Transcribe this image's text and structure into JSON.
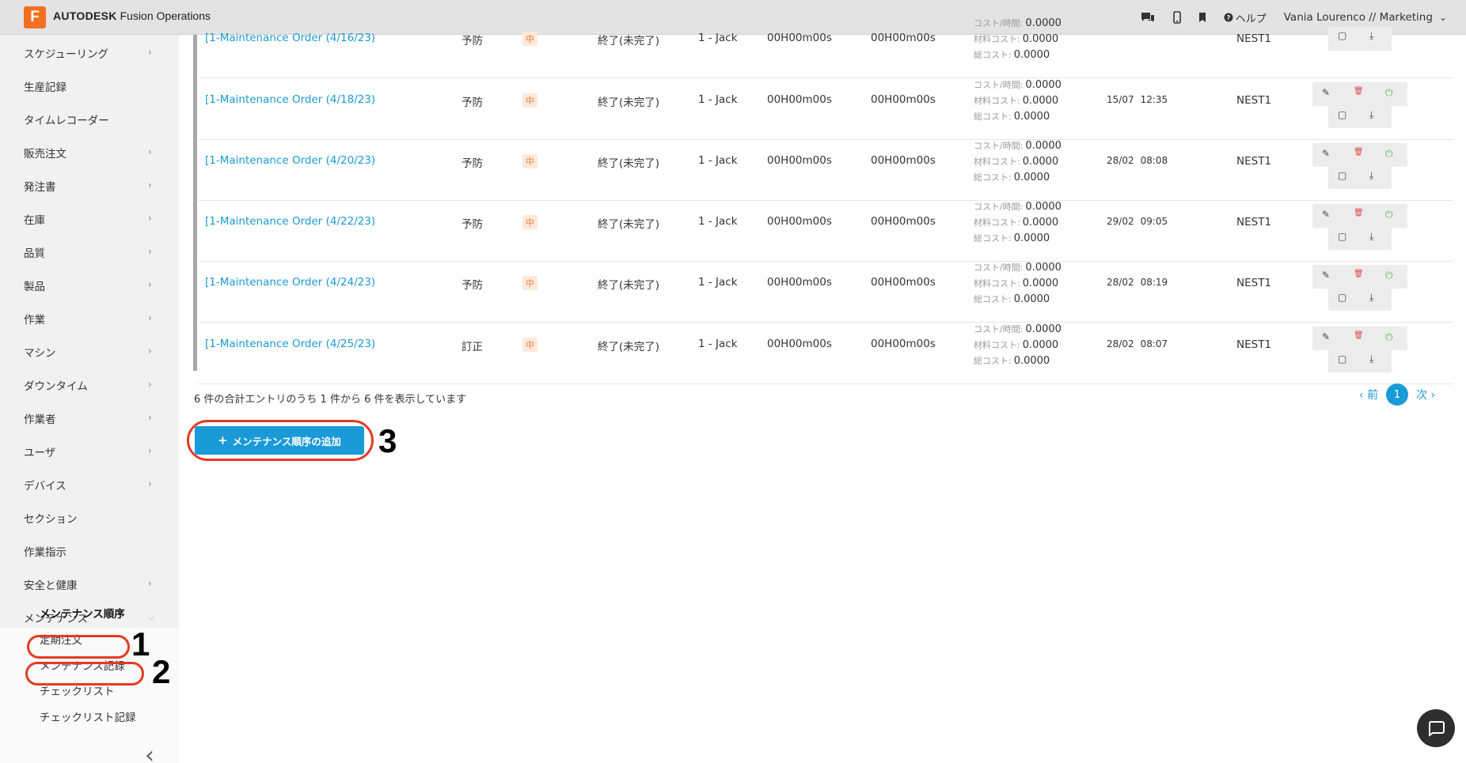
{
  "header": {
    "logo_letter": "F",
    "brand_bold": "AUTODESK",
    "brand_product": "Fusion Operations",
    "help_label": "ヘルプ",
    "user_label": "Vania Lourenco // Marketing"
  },
  "sidebar": {
    "items": [
      {
        "label": "スケジューリング",
        "chevron": true
      },
      {
        "label": "生産記録",
        "chevron": false
      },
      {
        "label": "タイムレコーダー",
        "chevron": false
      },
      {
        "label": "販売注文",
        "chevron": true
      },
      {
        "label": "発注書",
        "chevron": true
      },
      {
        "label": "在庫",
        "chevron": true
      },
      {
        "label": "品質",
        "chevron": true
      },
      {
        "label": "製品",
        "chevron": true
      },
      {
        "label": "作業",
        "chevron": true
      },
      {
        "label": "マシン",
        "chevron": true
      },
      {
        "label": "ダウンタイム",
        "chevron": true
      },
      {
        "label": "作業者",
        "chevron": true
      },
      {
        "label": "ユーザ",
        "chevron": true
      },
      {
        "label": "デバイス",
        "chevron": true
      },
      {
        "label": "セクション",
        "chevron": false
      },
      {
        "label": "作業指示",
        "chevron": false
      },
      {
        "label": "安全と健康",
        "chevron": true
      },
      {
        "label": "メンテナンス",
        "chevron": true
      }
    ],
    "sub_items": [
      {
        "label": "メンテナンス順序",
        "active": true
      },
      {
        "label": "定期注文",
        "active": false
      },
      {
        "label": "メンテナンス記録",
        "active": false
      },
      {
        "label": "チェックリスト",
        "active": false
      },
      {
        "label": "チェックリスト記録",
        "active": false
      }
    ]
  },
  "table": {
    "cost_labels": {
      "per_hour": "コスト/時間:",
      "material": "材料コスト:",
      "total": "総コスト:"
    },
    "rows": [
      {
        "order": "[1-Maintenance Order (4/16/23)",
        "type": "予防",
        "priority": "中",
        "status": "終了(未完了)",
        "operator": "1 - Jack",
        "time1": "00H00m00s",
        "time2": "00H00m00s",
        "cost_hour": "0.0000",
        "cost_material": "0.0000",
        "cost_total": "0.0000",
        "date": "",
        "time": "",
        "location": "NEST1"
      },
      {
        "order": "[1-Maintenance Order (4/18/23)",
        "type": "予防",
        "priority": "中",
        "status": "終了(未完了)",
        "operator": "1 - Jack",
        "time1": "00H00m00s",
        "time2": "00H00m00s",
        "cost_hour": "0.0000",
        "cost_material": "0.0000",
        "cost_total": "0.0000",
        "date": "15/07",
        "time": "12:35",
        "location": "NEST1"
      },
      {
        "order": "[1-Maintenance Order (4/20/23)",
        "type": "予防",
        "priority": "中",
        "status": "終了(未完了)",
        "operator": "1 - Jack",
        "time1": "00H00m00s",
        "time2": "00H00m00s",
        "cost_hour": "0.0000",
        "cost_material": "0.0000",
        "cost_total": "0.0000",
        "date": "28/02",
        "time": "08:08",
        "location": "NEST1"
      },
      {
        "order": "[1-Maintenance Order (4/22/23)",
        "type": "予防",
        "priority": "中",
        "status": "終了(未完了)",
        "operator": "1 - Jack",
        "time1": "00H00m00s",
        "time2": "00H00m00s",
        "cost_hour": "0.0000",
        "cost_material": "0.0000",
        "cost_total": "0.0000",
        "date": "29/02",
        "time": "09:05",
        "location": "NEST1"
      },
      {
        "order": "[1-Maintenance Order (4/24/23)",
        "type": "予防",
        "priority": "中",
        "status": "終了(未完了)",
        "operator": "1 - Jack",
        "time1": "00H00m00s",
        "time2": "00H00m00s",
        "cost_hour": "0.0000",
        "cost_material": "0.0000",
        "cost_total": "0.0000",
        "date": "28/02",
        "time": "08:19",
        "location": "NEST1"
      },
      {
        "order": "[1-Maintenance Order (4/25/23)",
        "type": "訂正",
        "priority": "中",
        "status": "終了(未完了)",
        "operator": "1 - Jack",
        "time1": "00H00m00s",
        "time2": "00H00m00s",
        "cost_hour": "0.0000",
        "cost_material": "0.0000",
        "cost_total": "0.0000",
        "date": "28/02",
        "time": "08:07",
        "location": "NEST1"
      }
    ]
  },
  "footer": {
    "info_text": "6 件の合計エントリのうち 1 件から 6 件を表示しています",
    "prev_label": "前",
    "current_page": "1",
    "next_label": "次"
  },
  "add_button_label": "メンテナンス順序の追加",
  "annotations": {
    "n1": "1",
    "n2": "2",
    "n3": "3"
  },
  "colors": {
    "accent": "#1a9ad6",
    "brand": "#f36f21",
    "annotation": "#e23b23",
    "priority": "#f07c2f"
  }
}
